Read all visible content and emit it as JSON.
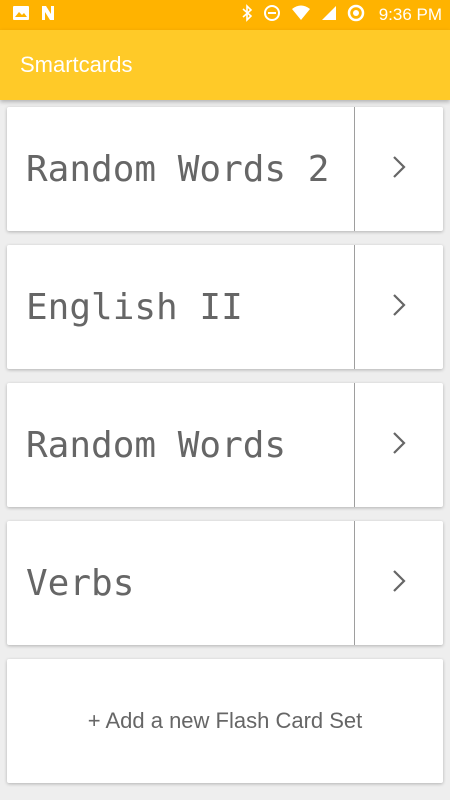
{
  "status_bar": {
    "time": "9:36 PM",
    "background": "#FFB300",
    "icons_left": [
      "image-icon",
      "n-icon"
    ],
    "icons_right": [
      "bluetooth-icon",
      "dnd-icon",
      "wifi-icon",
      "signal-icon",
      "data-saver-icon"
    ]
  },
  "app_bar": {
    "title": "Smartcards",
    "background": "#FFCA28"
  },
  "sets": [
    {
      "title": "Random Words 2",
      "icon": "chevron-right-icon"
    },
    {
      "title": "English II",
      "icon": "chevron-right-icon"
    },
    {
      "title": "Random Words",
      "icon": "chevron-right-icon"
    },
    {
      "title": "Verbs",
      "icon": "chevron-right-icon"
    }
  ],
  "add_button": {
    "label": "+ Add a new Flash Card Set"
  }
}
